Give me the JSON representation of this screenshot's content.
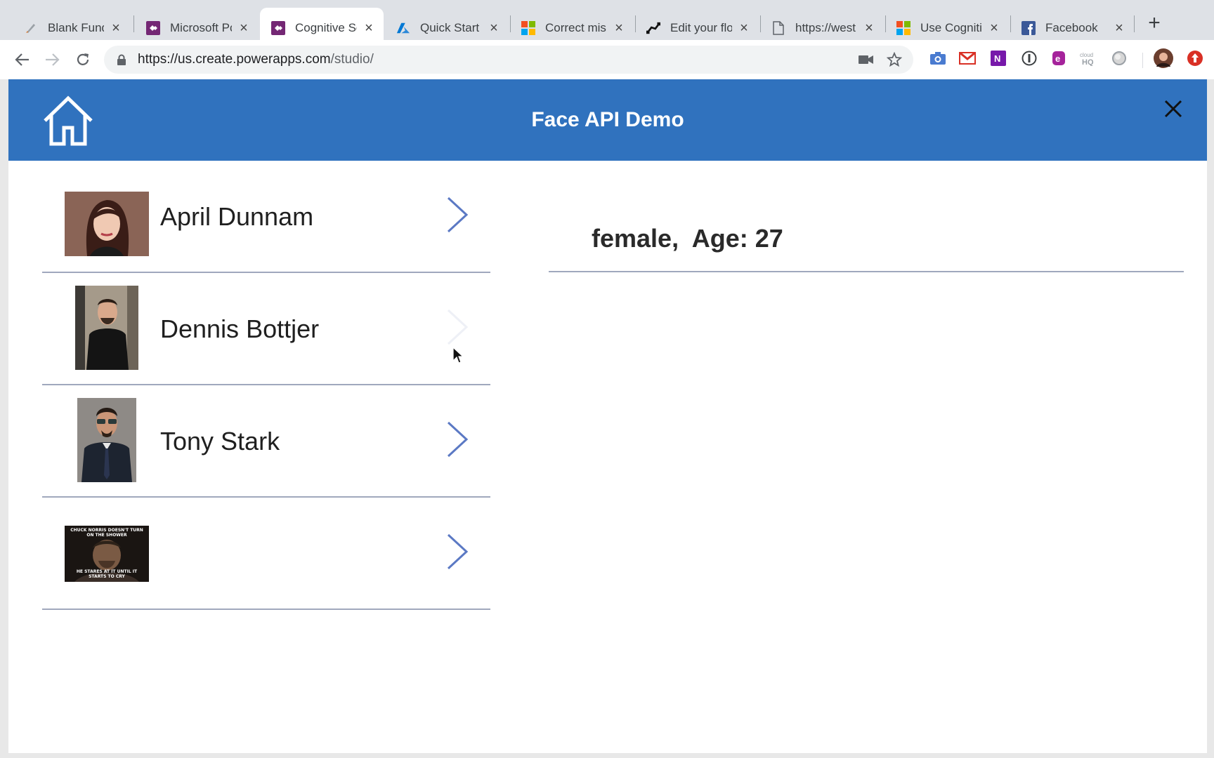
{
  "browser": {
    "tabs": [
      {
        "title": "Blank Fundr",
        "icon": "pen-icon",
        "active": false
      },
      {
        "title": "Microsoft Pc",
        "icon": "powerapps-icon",
        "active": false
      },
      {
        "title": "Cognitive Se",
        "icon": "powerapps-icon",
        "active": true
      },
      {
        "title": "Quick Start",
        "icon": "azure-icon",
        "active": false
      },
      {
        "title": "Correct mis",
        "icon": "microsoft-icon",
        "active": false
      },
      {
        "title": "Edit your flo",
        "icon": "flow-icon",
        "active": false
      },
      {
        "title": "https://west",
        "icon": "document-icon",
        "active": false
      },
      {
        "title": "Use Cogniti",
        "icon": "microsoft-icon",
        "active": false
      },
      {
        "title": "Facebook",
        "icon": "facebook-icon",
        "active": false
      }
    ],
    "address": {
      "host": "https://us.create.powerapps.com",
      "path": "/studio/"
    },
    "extension_icons": [
      "camera-icon",
      "gmail-icon",
      "onenote-icon",
      "1password-icon",
      "evernote-icon",
      "cloudhq-icon",
      "circle-icon",
      "profile-avatar",
      "update-icon"
    ]
  },
  "app": {
    "title": "Face API Demo",
    "people": [
      {
        "name": "April Dunnam"
      },
      {
        "name": "Dennis Bottjer"
      },
      {
        "name": "Tony Stark"
      },
      {
        "name": "",
        "meme_top": "CHUCK NORRIS DOESN'T TURN ON THE SHOWER",
        "meme_bottom": "HE STARES AT IT UNTIL IT STARTS TO CRY"
      }
    ],
    "detail": {
      "gender": "female",
      "age_label": "Age:",
      "age": "27"
    }
  },
  "colors": {
    "header": "#3072be",
    "chevron": "#5b79c4",
    "divider": "#a0a8bd"
  }
}
